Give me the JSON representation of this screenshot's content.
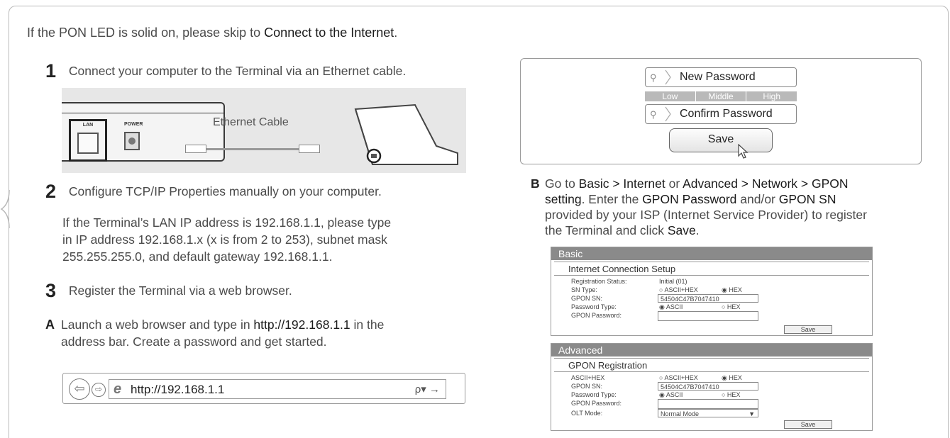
{
  "intro": {
    "text": "If the PON LED is solid on, please skip to ",
    "link": "Connect to the Internet",
    "end": "."
  },
  "step1": {
    "num": "1",
    "text": "Connect your computer to the Terminal via an Ethernet cable."
  },
  "illustration": {
    "lan_label": "LAN",
    "power_label": "POWER",
    "cable_label": "Ethernet Cable"
  },
  "step2": {
    "num": "2",
    "text": "Configure TCP/IP Properties manually on your computer.",
    "detail_l1": "If the Terminal’s LAN IP address is 192.168.1.1, please type",
    "detail_l2": "in IP address 192.168.1.x (x is from 2 to 253), subnet mask",
    "detail_l3": "255.255.255.0, and default gateway 192.168.1.1."
  },
  "step3": {
    "num": "3",
    "text": "Register the Terminal via a web browser."
  },
  "stepA": {
    "letter": "A",
    "pre": "Launch a web browser and type in ",
    "url": "http://192.168.1.1",
    "post": " in the",
    "line2": "address bar. Create a password and get started."
  },
  "browser": {
    "url": "http://192.168.1.1",
    "tools": "ρ▾ →"
  },
  "password_form": {
    "new_password": "New Password",
    "strength": [
      "Low",
      "Middle",
      "High"
    ],
    "confirm_password": "Confirm Password",
    "save": "Save"
  },
  "stepB": {
    "letter": "B",
    "t1": "Go to ",
    "basic_internet": "Basic > Internet",
    "t2": " or ",
    "adv_path": "Advanced > Network > GPON",
    "l2a": "setting",
    "l2b": ". Enter the ",
    "gpon_pw": "GPON Password",
    "l2c": " and/or ",
    "gpon_sn": "GPON SN",
    "line3": "provided by your ISP (Internet Service Provider) to register",
    "l4a": "the Terminal and click ",
    "save": "Save",
    "l4b": "."
  },
  "basic_panel": {
    "header": "Basic",
    "section": "Internet Connection Setup",
    "rows": [
      {
        "label": "Registration Status:",
        "value": "Initial (01)"
      },
      {
        "label": "SN Type:",
        "opt1": "○ ASCII+HEX",
        "opt2": "◉ HEX"
      },
      {
        "label": "GPON SN:",
        "value": "54504C47B7047410"
      },
      {
        "label": "Password Type:",
        "opt1": "◉ ASCII",
        "opt2": "○ HEX"
      },
      {
        "label": "GPON Password:",
        "value": ""
      }
    ],
    "save": "Save"
  },
  "advanced_panel": {
    "header": "Advanced",
    "section": "GPON Registration",
    "rows": [
      {
        "label": "ASCII+HEX",
        "opt1": "○ ASCII+HEX",
        "opt2": "◉ HEX"
      },
      {
        "label": "GPON SN:",
        "value": "54504C47B7047410"
      },
      {
        "label": "Password Type:",
        "opt1": "◉ ASCII",
        "opt2": "○ HEX"
      },
      {
        "label": "GPON Password:",
        "value": ""
      },
      {
        "label": "OLT Mode:",
        "value": "Normal Mode"
      }
    ],
    "save": "Save"
  }
}
